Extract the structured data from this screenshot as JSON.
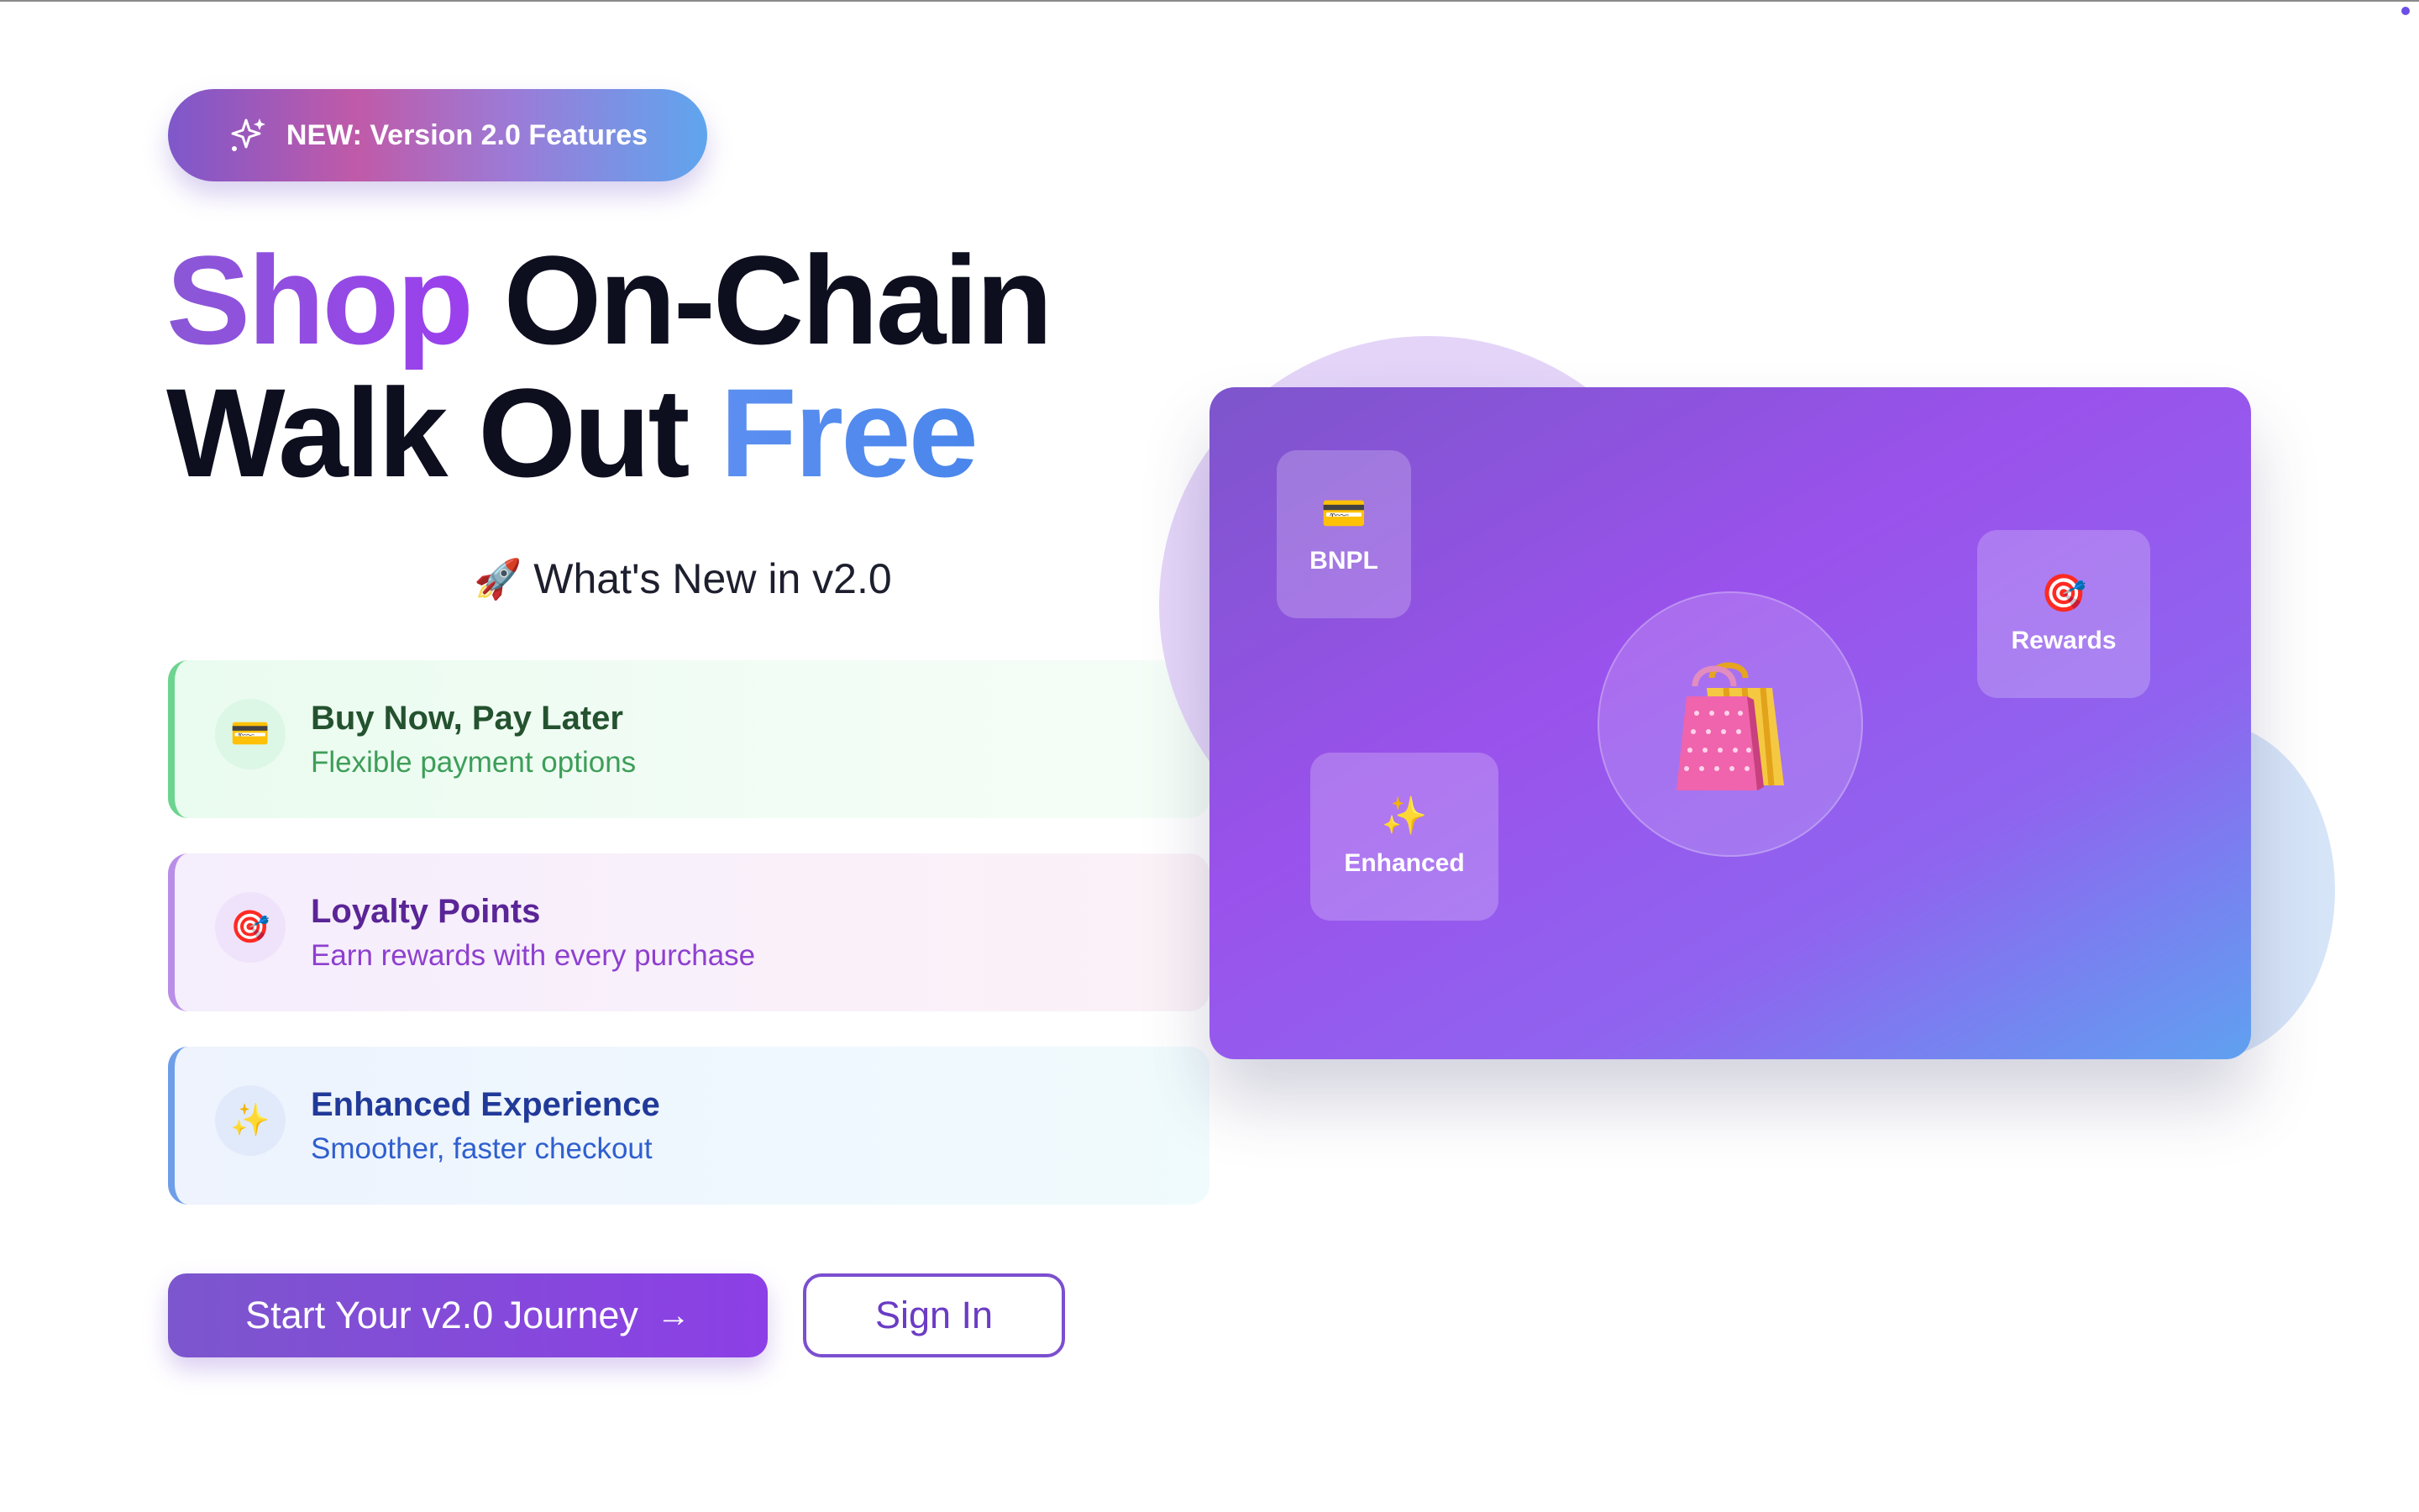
{
  "badge": {
    "label": "NEW: Version 2.0 Features",
    "icon": "sparkles-icon"
  },
  "headline": {
    "line1_accent": "Shop",
    "line1_rest": " On-Chain",
    "line2_rest": "Walk Out ",
    "line2_accent": "Free"
  },
  "whats_new": {
    "emoji": "🚀",
    "label": "What's New in v2.0"
  },
  "features": [
    {
      "icon": "💳",
      "title": "Buy Now, Pay Later",
      "subtitle": "Flexible payment options"
    },
    {
      "icon": "🎯",
      "title": "Loyalty Points",
      "subtitle": "Earn rewards with every purchase"
    },
    {
      "icon": "✨",
      "title": "Enhanced Experience",
      "subtitle": "Smoother, faster checkout"
    }
  ],
  "actions": {
    "primary_label": "Start Your v2.0 Journey",
    "primary_arrow": "→",
    "secondary_label": "Sign In"
  },
  "hero_card": {
    "chips": [
      {
        "emoji": "💳",
        "label": "BNPL"
      },
      {
        "emoji": "🎯",
        "label": "Rewards"
      },
      {
        "emoji": "✨",
        "label": "Enhanced"
      }
    ],
    "center_icon": "shopping-bags-icon"
  },
  "colors": {
    "accent_purple": "#8c3fe6",
    "accent_blue": "#4a86ec",
    "green": "#3d9e59",
    "violet": "#8e3fcf",
    "blue": "#2f5fcf"
  }
}
